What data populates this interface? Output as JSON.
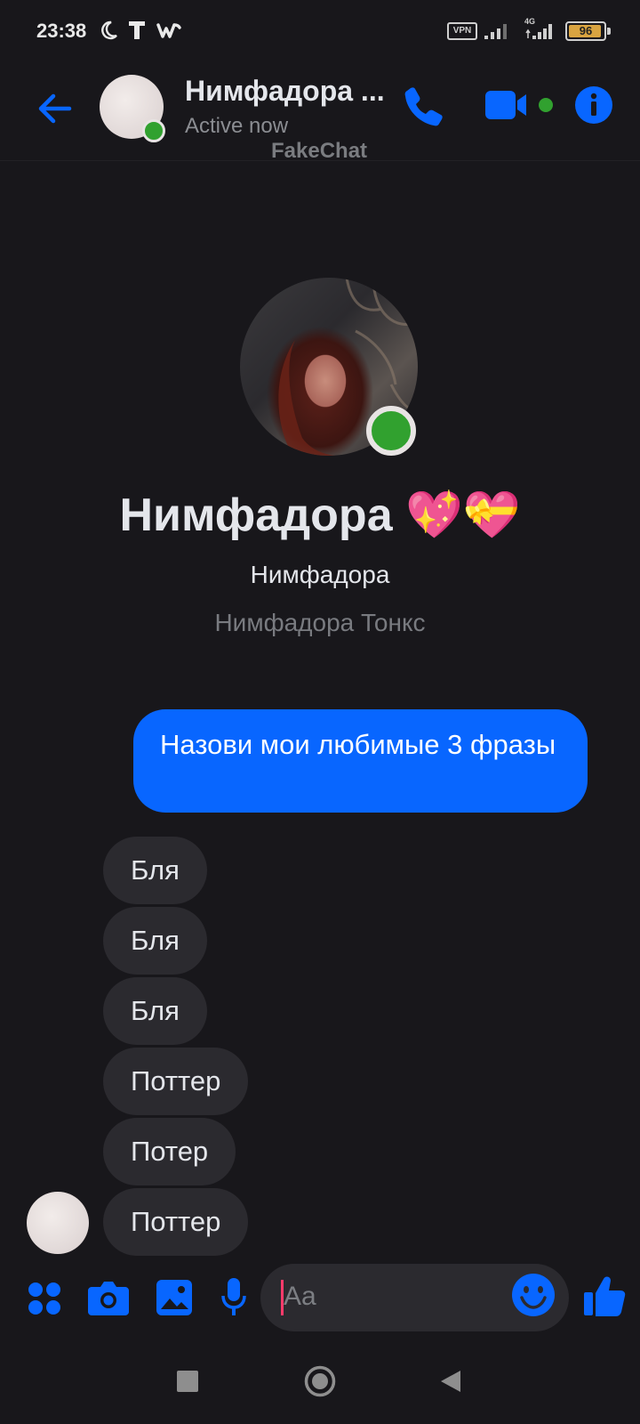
{
  "status_bar": {
    "time": "23:38",
    "vpn": "VPN",
    "network": "4G",
    "battery": "96",
    "battery_level": 0.96,
    "icons": [
      "moon-icon",
      "t-app-icon",
      "w-app-icon",
      "signal-icon",
      "signal-4g-icon",
      "battery-icon"
    ]
  },
  "header": {
    "name": "Нимфадора ...",
    "status": "Active now",
    "watermark": "FakeChat"
  },
  "profile": {
    "title": "Нимфадора 💖💝",
    "subtitle": "Нимфадора",
    "full_name": "Нимфадора Тонкс"
  },
  "messages": {
    "sent": [
      {
        "text": "Назови мои любимые 3 фразы"
      }
    ],
    "received": [
      {
        "text": "Бля"
      },
      {
        "text": "Бля"
      },
      {
        "text": "Бля"
      },
      {
        "text": "Поттер"
      },
      {
        "text": "Потер"
      },
      {
        "text": "Поттер"
      }
    ]
  },
  "composer": {
    "placeholder": "Aa"
  },
  "colors": {
    "accent": "#0866ff",
    "background": "#18171b",
    "bubble_received": "#2b2a2f",
    "online": "#31a12f"
  }
}
